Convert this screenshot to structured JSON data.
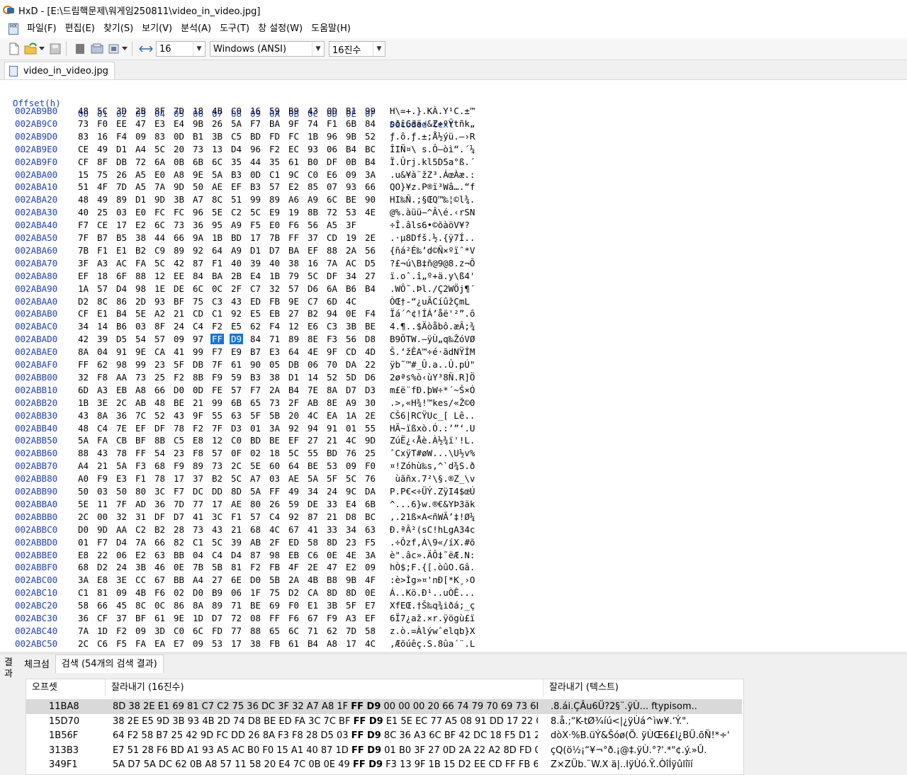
{
  "window": {
    "title": "HxD - [E:\\드림핵문제\\워게임250811\\video_in_video.jpg]"
  },
  "menu": [
    "파일(F)",
    "편집(E)",
    "찾기(S)",
    "보기(V)",
    "분석(A)",
    "도구(T)",
    "창 설정(W)",
    "도움말(H)"
  ],
  "toolbar": {
    "bytes_per_row": "16",
    "charset": "Windows (ANSI)",
    "base": "16진수"
  },
  "tab": {
    "label": "video_in_video.jpg"
  },
  "hex": {
    "header_offset": "Offset(h)",
    "columns": [
      "00",
      "01",
      "02",
      "03",
      "04",
      "05",
      "06",
      "07",
      "08",
      "09",
      "0A",
      "0B",
      "0C",
      "0D",
      "0E",
      "0F"
    ],
    "header_decoded": "Decoded text",
    "rows": [
      {
        "o": "002AB9B0",
        "b": "48 5C 3D 2B 8F 7D 18 4B C0 16 59 B9 43 0D B1 99",
        "t": "H\\=+.}.KÀ.Y¹C.±™"
      },
      {
        "o": "002AB9C0",
        "b": "73 F0 EE 47 E3 E4 9B 26 5A F7 BA 9F 74 F1 6B 84",
        "t": "sðîGãä›&Z÷ºŸtñk„"
      },
      {
        "o": "002AB9D0",
        "b": "83 16 F4 09 83 0D B1 3B C5 BD FD FC 1B 96 9B 52",
        "t": "ƒ.ô.ƒ.±;Å½ýü.–›R"
      },
      {
        "o": "002AB9E0",
        "b": "CE 49 D1 A4 5C 20 73 13 D4 96 F2 EC 93 06 B4 BC",
        "t": "ÎIÑ¤\\ s.Ô–òì“.´¼"
      },
      {
        "o": "002AB9F0",
        "b": "CF 8F DB 72 6A 0B 6B 6C 35 44 35 61 B0 DF 0B B4",
        "t": "Ï.Ûrj.kl5D5a°ß.´"
      },
      {
        "o": "002ABA00",
        "b": "15 75 26 A5 E0 A8 9E 5A B3 0D C1 9C C0 E6 09 3A",
        "t": ".u&¥à¨žZ³.ÁœÀæ.:"
      },
      {
        "o": "002ABA10",
        "b": "51 4F 7D A5 7A 9D 50 AE EF B3 57 E2 85 07 93 66",
        "t": "QO}¥z.P®ï³Wâ….“f"
      },
      {
        "o": "002ABA20",
        "b": "48 49 89 D1 9D 3B A7 8C 51 99 89 A6 A9 6C BE 90",
        "t": "HI‰Ñ.;§ŒQ™‰¦©l¾."
      },
      {
        "o": "002ABA30",
        "b": "40 25 03 E0 FC FC 96 5E C2 5C E9 19 8B 72 53 4E",
        "t": "@%.àüü–^Â\\é.‹rSN"
      },
      {
        "o": "002ABA40",
        "b": "F7 CE 17 E2 6C 73 36 95 A9 F5 E0 F6 56 A5 3F",
        "t": "÷Î.âls6•©õàöV¥?"
      },
      {
        "o": "002ABA50",
        "b": "7F B7 B5 38 44 66 9A 1B BD 17 7B FF 37 CD 19 2E",
        "t": ".·µ8Dfš.½.{ÿ7Í.."
      },
      {
        "o": "002ABA60",
        "b": "7B F1 E1 B2 C9 89 92 64 A9 D1 D7 BA EF 88 2A 56",
        "t": "{ñá²É‰’d©Ñ×ºïˆ*V"
      },
      {
        "o": "002ABA70",
        "b": "3F A3 AC FA 5C 42 87 F1 40 39 40 38 16 7A AC D5",
        "t": "?£¬ú\\B‡ñ@9@8.z¬Õ"
      },
      {
        "o": "002ABA80",
        "b": "EF 18 6F 88 12 EE 84 BA 2B E4 1B 79 5C DF 34 27",
        "t": "ï.oˆ.î„º+ä.y\\ß4'"
      },
      {
        "o": "002ABA90",
        "b": "1A 57 D4 98 1E DE 6C 0C 2F C7 32 57 D6 6A B6 B4",
        "t": ".WÔ˜.Þl./Ç2WÖj¶´"
      },
      {
        "o": "002ABAA0",
        "b": "D2 8C 86 2D 93 BF 75 C3 43 ED FB 9E C7 6D 4C",
        "t": "ÒŒ†-“¿uÃCíûžÇmL"
      },
      {
        "o": "002ABAB0",
        "b": "CF E1 B4 5E A2 21 CD C1 92 E5 EB 27 B2 94 0E F4",
        "t": "Ïá´^¢!ÍÁ’åë'²”.ô"
      },
      {
        "o": "002ABAC0",
        "b": "34 14 B6 03 8F 24 C4 F2 E5 62 F4 12 E6 C3 3B BE",
        "t": "4.¶..$Äòåbô.æÃ;¾"
      },
      {
        "o": "002ABAD0",
        "b": "42 39 D5 54 57 09 97 FF D9 84 71 89 8E F3 56 D8",
        "t": "B9ÕTW.—ÿÙ„q‰ŽóVØ"
      },
      {
        "o": "002ABAE0",
        "b": "8A 04 91 9E CA 41 99 F7 E9 B7 E3 64 4E 9F CD 4D",
        "t": "Š.‘žÊA™÷é·ãdNŸÍM"
      },
      {
        "o": "002ABAF0",
        "b": "FF 62 98 99 23 5F DB 7F 61 90 05 DB 06 70 DA 22",
        "t": "ÿb˜™#_Û.a..Û.pÚ\""
      },
      {
        "o": "002ABB00",
        "b": "32 F8 AA 73 25 F2 8B F9 59 B3 38 D1 14 52 5D D6",
        "t": "2øªs%ò‹ùY³8Ñ.R]Ö"
      },
      {
        "o": "002ABB10",
        "b": "6D A3 EB A8 66 D0 0D FE 57 F7 2A B4 7E 8A D7 D3",
        "t": "m£ë¨fÐ.þW÷*´~Š×Ó"
      },
      {
        "o": "002ABB20",
        "b": "1B 3E 2C AB 48 BE 21 99 6B 65 73 2F AB 8E A9 30",
        "t": ".>,«H¾!™kes/«Ž©0"
      },
      {
        "o": "002ABB30",
        "b": "43 8A 36 7C 52 43 9F 55 63 5F 5B 20 4C EA 1A 2E",
        "t": "CŠ6|RCŸUc_[ Lê.."
      },
      {
        "o": "002ABB40",
        "b": "48 C4 7E EF DF 78 F2 7F D3 01 3A 92 94 91 01 55",
        "t": "HÄ~ïßxò.Ó.:’”‘.U"
      },
      {
        "o": "002ABB50",
        "b": "5A FA CB BF 8B C5 E8 12 C0 BD BE EF 27 21 4C 9D",
        "t": "ZúË¿‹Åè.À½¾ï'!L."
      },
      {
        "o": "002ABB60",
        "b": "88 43 78 FF 54 23 F8 57 0F 02 18 5C 55 BD 76 25",
        "t": "ˆCxÿT#øW...\\U½v%"
      },
      {
        "o": "002ABB70",
        "b": "A4 21 5A F3 68 F9 89 73 2C 5E 60 64 BE 53 09 F0",
        "t": "¤!Zóhù‰s,^`d¾S.ð"
      },
      {
        "o": "002ABB80",
        "b": "A0 F9 E3 F1 78 17 37 B2 5C A7 03 AE 5A 5F 5C 76",
        "t": " ùãñx.7²\\§.®Z_\\v"
      },
      {
        "o": "002ABB90",
        "b": "50 03 50 80 3C F7 DC DD 8D 5A FF 49 34 24 9C DA",
        "t": "P.P€<÷ÜÝ.ZÿI4$œÚ"
      },
      {
        "o": "002ABBA0",
        "b": "5E 11 7F AD 36 7D 77 17 AE 80 26 59 DE 33 E4 6B",
        "t": "^...6}w.®€&YÞ3äk"
      },
      {
        "o": "002ABBB0",
        "b": "2C 00 32 31 DF D7 41 3C F1 57 C4 92 87 21 D8 BC",
        "t": ",.21ß×A<ñWÄ’‡!Ø¼"
      },
      {
        "o": "002ABBC0",
        "b": "D0 9D AA C2 B2 28 73 43 21 68 4C 67 41 33 34 63",
        "t": "Ð.ªÂ²(sC!hLgA34c"
      },
      {
        "o": "002ABBD0",
        "b": "01 F7 D4 7A 66 82 C1 5C 39 AB 2F ED 58 8D 23 F5",
        "t": ".÷Ôzf‚Á\\9«/íX.#õ"
      },
      {
        "o": "002ABBE0",
        "b": "E8 22 06 E2 63 BB 04 C4 D4 87 98 EB C6 0E 4E 3A",
        "t": "è\".âc».ÄÔ‡˜ëÆ.N:"
      },
      {
        "o": "002ABBF0",
        "b": "68 D2 24 3B 46 0E 7B 5B 81 F2 FB 4F 2E 47 E2 09",
        "t": "hÒ$;F.{[.òûO.Gâ."
      },
      {
        "o": "002ABC00",
        "b": "3A E8 3E CC 67 BB A4 27 6E D0 5B 2A 4B B8 9B 4F",
        "t": ":è>Ìg»¤'nÐ[*K¸›O"
      },
      {
        "o": "002ABC10",
        "b": "C1 81 09 4B F6 02 D0 B9 06 1F 75 D2 CA 8D 8D 0E",
        "t": "Á..Kö.Ð¹..uÒÊ..."
      },
      {
        "o": "002ABC20",
        "b": "58 66 45 8C 0C 86 8A 89 71 BE 69 F0 E1 3B 5F E7",
        "t": "XfEŒ.†Š‰q¾iðá;_ç"
      },
      {
        "o": "002ABC30",
        "b": "36 CF 37 BF 61 9E 1D D7 72 08 FF F6 67 F9 A3 EF",
        "t": "6Ï7¿až.×r.ÿögù£ï"
      },
      {
        "o": "002ABC40",
        "b": "7A 1D F2 09 3D C0 6C FD 77 88 65 6C 71 62 7D 58",
        "t": "z.ò.=Àlýwˆelqb}X"
      },
      {
        "o": "002ABC50",
        "b": "2C C6 F5 FA EA E7 09 53 17 38 FB 61 B4 A8 17 4C",
        "t": ",Æõúêç.S.8ûa´¨.L"
      }
    ]
  },
  "results": {
    "side_label": "결과",
    "tabs": [
      "체크섬",
      "검색 (54개의 검색 결과)"
    ],
    "headers": [
      "오프셋",
      "잘라내기 (16진수)",
      "잘라내기 (텍스트)"
    ],
    "rows": [
      {
        "offset": "11BA8",
        "pre": "8D 38 2E E1 69 81 C7 C2 75 36 DC 3F 32 A7 A8 1F",
        "hit": "FF D9",
        "post": "00 00 00 20 66 74 79 70 69 73 6F ...",
        "text": ".8.ái.ÇÂu6Ü?2§¨.ÿÙ... ftypisom.."
      },
      {
        "offset": "15D70",
        "pre": "38 2E E5 9D 3B 93 4B 2D 74 D8 BE ED FA 3C 7C BF",
        "hit": "FF D9",
        "post": "E1 5E EC 77 A5 08 91 DD 17 22 0C...",
        "text": "8.å.;“K-tØ¾íú<|¿ÿÙá^ìw¥.‘Ý.\"."
      },
      {
        "offset": "1B56F",
        "pre": "64 F2 58 B7 25 42 9D FC DD 26 8A F3 F8 28 D5 03",
        "hit": "FF D9",
        "post": "8C 36 A3 6C BF 42 DC 18 F5 D1 2...",
        "text": "dòX·%B.üÝ&Šóø(Õ. ÿÙŒ6£l¿BÜ.õÑ!*÷'"
      },
      {
        "offset": "313B3",
        "pre": "E7 51 28 F6 BD A1 93 A5 AC B0 F0 15 A1 40 87 1D",
        "hit": "FF D9",
        "post": "01 B0 3F 27 0D 2A 22 A2 8D FD 0E...",
        "text": "çQ(ö½¡“¥¬°ð.¡@‡.ÿÙ.°?'.*\"¢.ý.»Û."
      },
      {
        "offset": "349F1",
        "pre": "5A D7 5A DC 62 0B A8 57 11 58 20 E4 7C 0B 0E 49",
        "hit": "FF D9",
        "post": "F3 13 9F 1B 15 D2 EE CD FF FB 6C ...",
        "text": "Z×ZÜb.¨W.X ä|..IÿÙó.Ÿ..ÒîÍÿûlîïí"
      }
    ]
  },
  "colors": {
    "offset": "#1f3fbf",
    "selection": "#1874d6",
    "highlight_row": "#d9d9d9"
  }
}
